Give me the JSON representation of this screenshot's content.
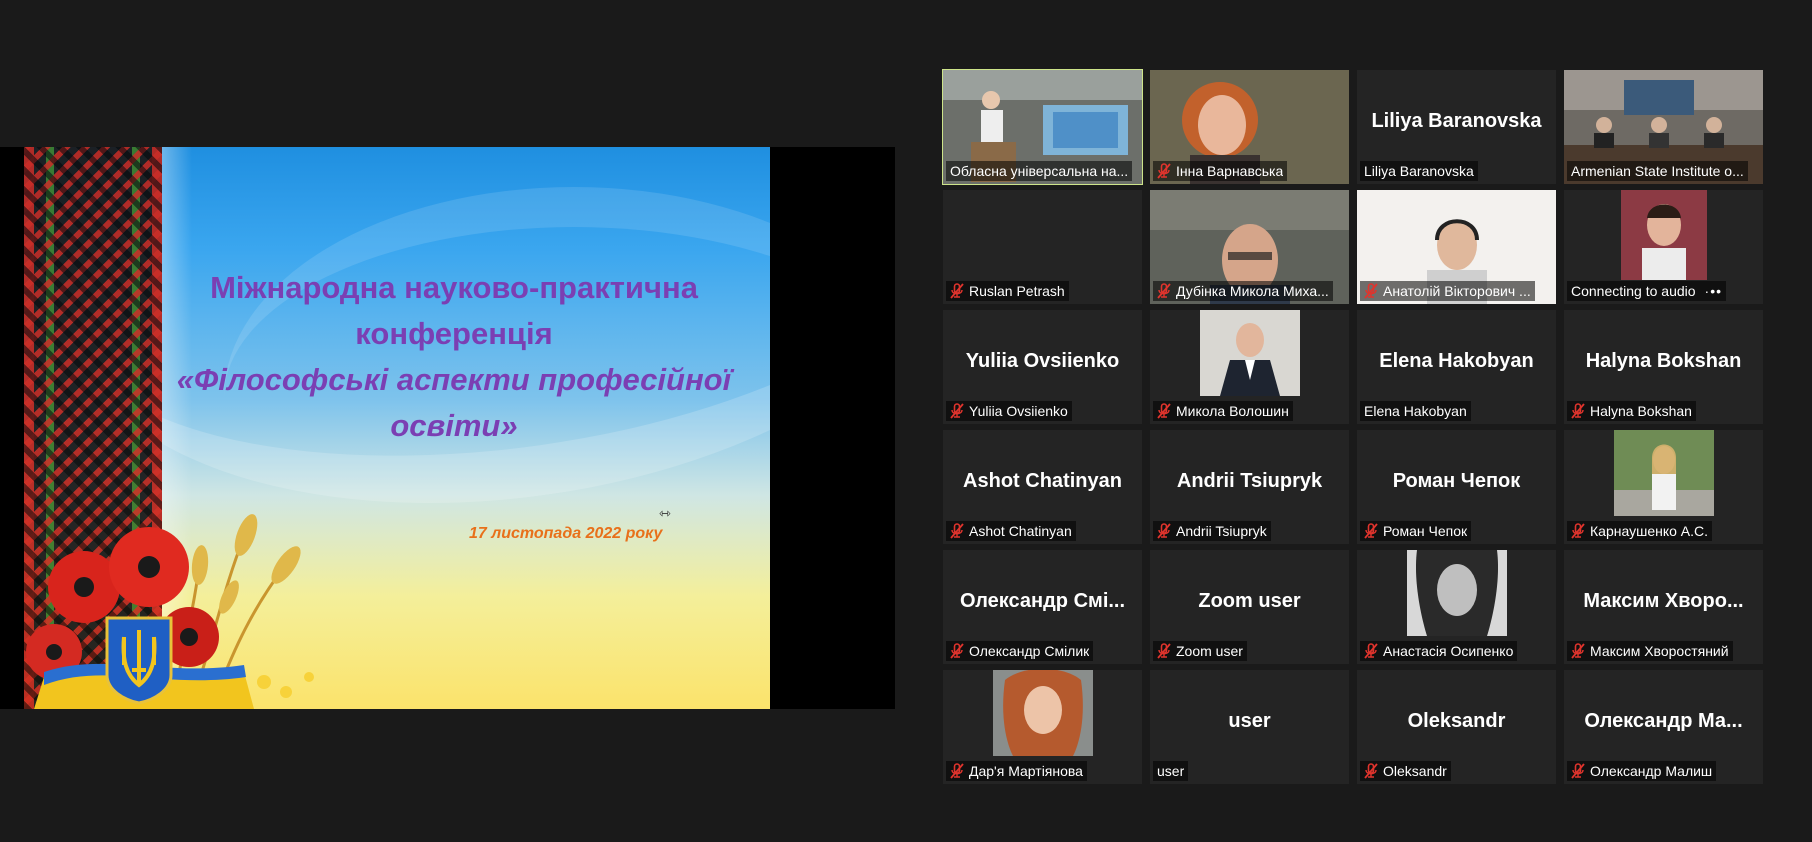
{
  "slide": {
    "title_line1": "Міжнародна  науково-практична",
    "title_line2": "конференція",
    "title_line3": "«Філософські аспекти професійної",
    "title_line4": "освіти»",
    "date": "17 листопада 2022 року"
  },
  "colors": {
    "active_speaker_border": "#cde48a",
    "tile_bg": "#242424",
    "muted_mic": "#e0342d",
    "slide_title": "#7b3fb3",
    "slide_date": "#e8701a"
  },
  "participants": [
    {
      "label": "Обласна універсальна на...",
      "display_name": "",
      "muted": false,
      "feed": "video-lecture-room",
      "active": true
    },
    {
      "label": "Інна Варнавська",
      "display_name": "",
      "muted": true,
      "feed": "video-woman-red-hair"
    },
    {
      "label": "Liliya Baranovska",
      "display_name": "Liliya Baranovska",
      "muted": false,
      "feed": "none"
    },
    {
      "label": "Armenian State Institute o...",
      "display_name": "",
      "muted": false,
      "feed": "video-conference-hall"
    },
    {
      "label": "Ruslan Petrash",
      "display_name": "",
      "muted": true,
      "feed": "none"
    },
    {
      "label": "Дубінка Микола Миха...",
      "display_name": "",
      "muted": true,
      "feed": "video-man-glasses"
    },
    {
      "label": "Анатолій Вікторович ...",
      "display_name": "",
      "muted": true,
      "feed": "video-man-headset"
    },
    {
      "label": "Connecting to audio",
      "display_name": "",
      "muted": false,
      "feed": "video-young-man",
      "connecting": true
    },
    {
      "label": "Yuliia Ovsiienko",
      "display_name": "Yuliia Ovsiienko",
      "muted": true,
      "feed": "none"
    },
    {
      "label": "Микола Волошин",
      "display_name": "",
      "muted": true,
      "feed": "photo-man-suit"
    },
    {
      "label": "Elena Hakobyan",
      "display_name": "Elena Hakobyan",
      "muted": false,
      "feed": "none"
    },
    {
      "label": "Halyna Bokshan",
      "display_name": "Halyna Bokshan",
      "muted": true,
      "feed": "none"
    },
    {
      "label": "Ashot Chatinyan",
      "display_name": "Ashot Chatinyan",
      "muted": true,
      "feed": "none"
    },
    {
      "label": "Andrii Tsiupryk",
      "display_name": "Andrii Tsiupryk",
      "muted": true,
      "feed": "none"
    },
    {
      "label": "Роман Чепок",
      "display_name": "Роман Чепок",
      "muted": true,
      "feed": "none"
    },
    {
      "label": "Карнаушенко А.С.",
      "display_name": "",
      "muted": true,
      "feed": "photo-woman-park"
    },
    {
      "label": "Олександр Смілик",
      "display_name": "Олександр  Смі...",
      "muted": true,
      "feed": "none"
    },
    {
      "label": "Zoom user",
      "display_name": "Zoom user",
      "muted": true,
      "feed": "none"
    },
    {
      "label": "Анастасія Осипенко",
      "display_name": "",
      "muted": true,
      "feed": "photo-woman-bw"
    },
    {
      "label": "Максим Хворостяний",
      "display_name": "Максим  Хворо...",
      "muted": true,
      "feed": "none"
    },
    {
      "label": "Дар'я Мартіянова",
      "display_name": "",
      "muted": true,
      "feed": "photo-woman-redhead"
    },
    {
      "label": "user",
      "display_name": "user",
      "muted": false,
      "feed": "none"
    },
    {
      "label": "Oleksandr",
      "display_name": "Oleksandr",
      "muted": true,
      "feed": "none"
    },
    {
      "label": "Олександр Малиш",
      "display_name": "Олександр  Ма...",
      "muted": true,
      "feed": "none"
    }
  ]
}
